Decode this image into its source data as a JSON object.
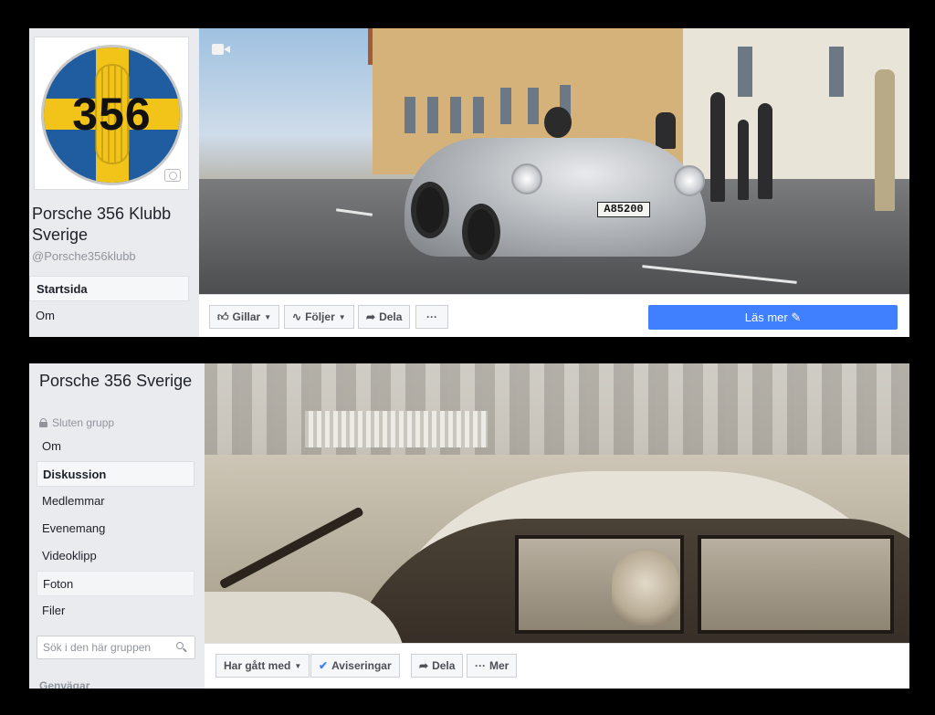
{
  "page_panel": {
    "name": "Porsche 356 Klubb Sverige",
    "handle": "@Porsche356klubb",
    "logo_text": "356",
    "nav": [
      "Startsida",
      "Om"
    ],
    "active_nav": "Startsida",
    "cover": {
      "plate_text": "A85200"
    },
    "actions": {
      "like": "Gillar",
      "follow": "Följer",
      "share": "Dela",
      "more": "···",
      "cta": "Läs mer"
    }
  },
  "group_panel": {
    "name": "Porsche 356 Sverige",
    "privacy": "Sluten grupp",
    "nav": [
      "Om",
      "Diskussion",
      "Medlemmar",
      "Evenemang",
      "Videoklipp",
      "Foton",
      "Filer"
    ],
    "active_nav": "Diskussion",
    "search_placeholder": "Sök i den här gruppen",
    "shortcuts_label": "Genvägar",
    "actions": {
      "joined": "Har gått med",
      "notifications": "Aviseringar",
      "share": "Dela",
      "more": "Mer"
    }
  },
  "colors": {
    "page_bg": "#000000",
    "sidebar_bg": "#e9ebee",
    "cta_blue": "#4080ff",
    "text": "#1d2129",
    "muted": "#90949c",
    "logo_blue": "#1f5da0",
    "logo_yellow": "#f2c318"
  },
  "icons": {
    "thumbs_up": "like-icon",
    "rss": "follow-icon",
    "share": "share-icon",
    "pencil": "pencil-icon",
    "lock": "lock-icon",
    "search": "search-icon",
    "check": "check-icon",
    "video": "video-icon",
    "camera": "camera-icon"
  }
}
